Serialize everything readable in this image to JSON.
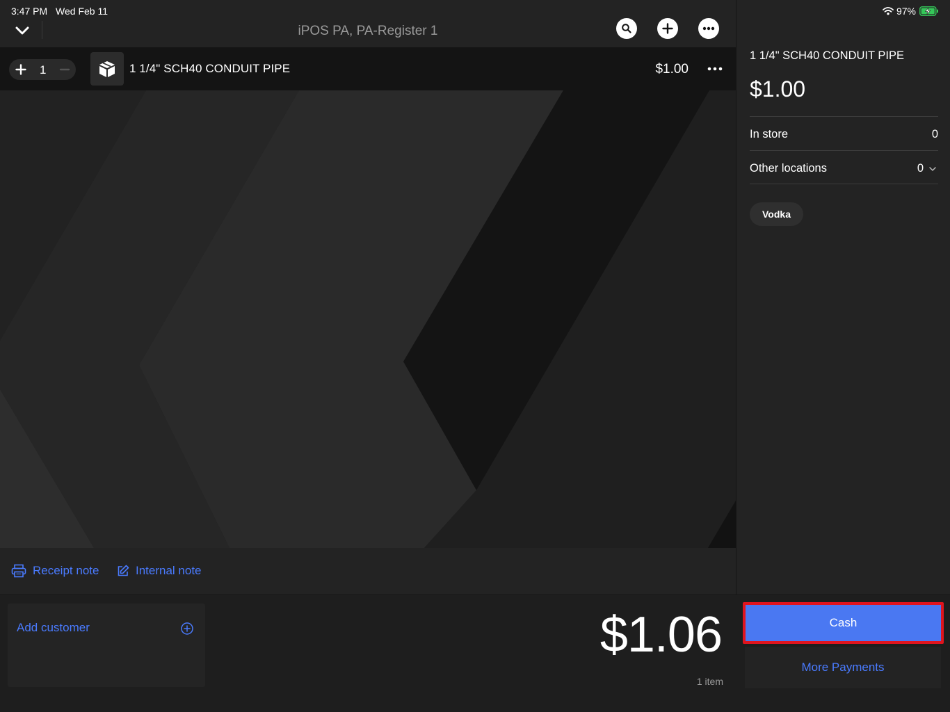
{
  "status_bar": {
    "time": "3:47 PM",
    "date": "Wed Feb 11",
    "battery": "97%"
  },
  "header": {
    "title": "iPOS PA, PA-Register 1"
  },
  "line_item": {
    "quantity": "1",
    "name": "1 1/4\" SCH40 CONDUIT PIPE",
    "price": "$1.00"
  },
  "notes": {
    "receipt_note_label": "Receipt note",
    "internal_note_label": "Internal note"
  },
  "detail_panel": {
    "name": "1 1/4\" SCH40 CONDUIT PIPE",
    "price": "$1.00",
    "in_store_label": "In store",
    "in_store_value": "0",
    "other_locations_label": "Other locations",
    "other_locations_value": "0",
    "tag": "Vodka"
  },
  "checkout": {
    "add_customer_label": "Add customer",
    "total": "$1.06",
    "item_count": "1 item",
    "cash_label": "Cash",
    "more_payments_label": "More Payments"
  },
  "colors": {
    "accent": "#4a7bff",
    "cash_button": "#4a78f2",
    "highlight_border": "#e0141e",
    "battery": "#35c759"
  }
}
